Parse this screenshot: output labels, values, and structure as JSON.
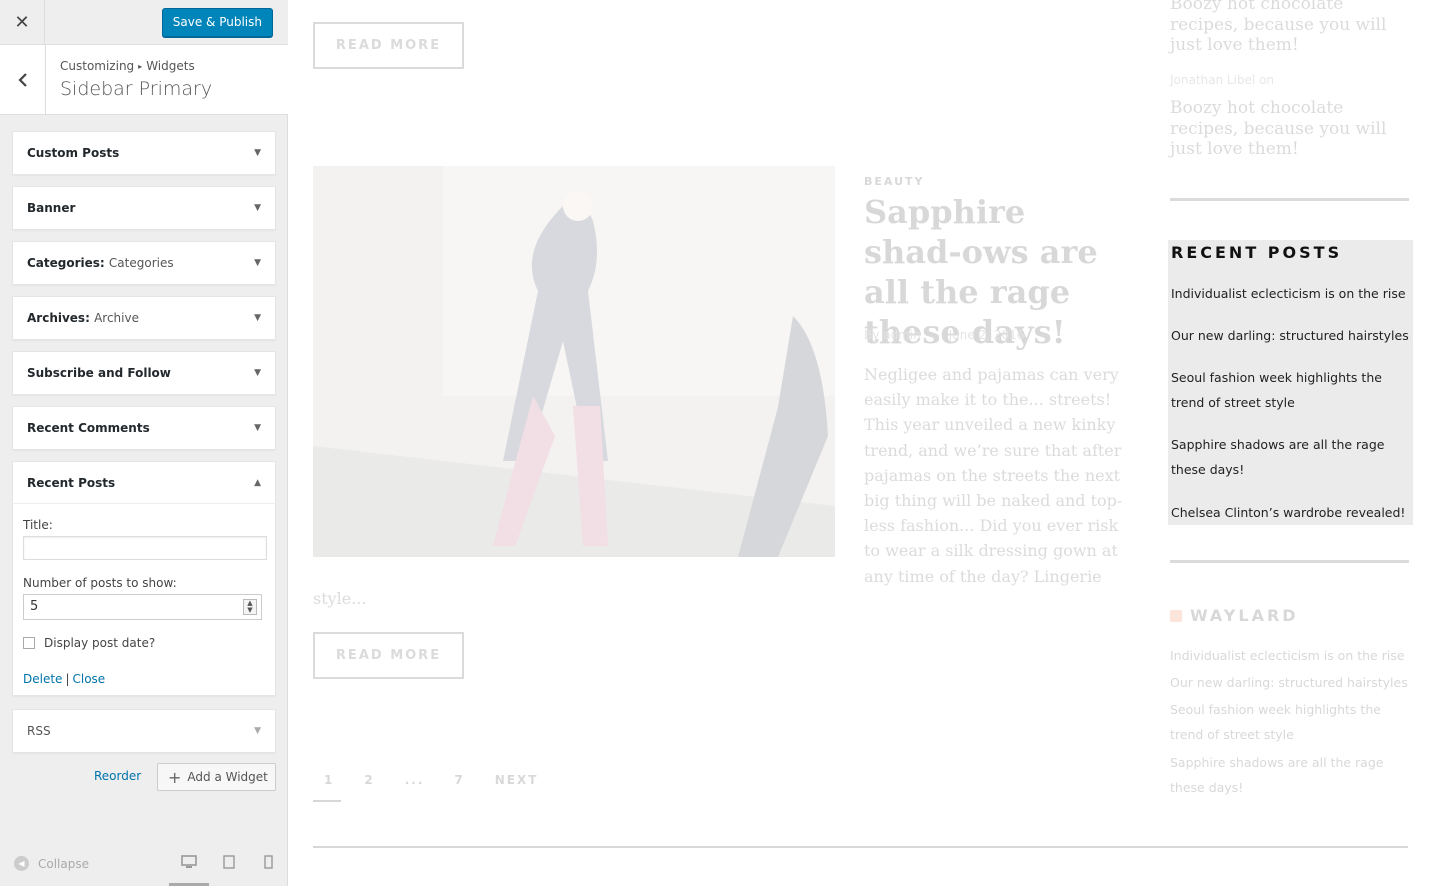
{
  "customizer": {
    "close_label": "✕",
    "save_label": "Save & Publish",
    "breadcrumb": {
      "root": "Customizing",
      "sep": "▸",
      "current": "Widgets"
    },
    "section_title": "Sidebar Primary",
    "widgets": [
      {
        "name": "Custom Posts",
        "sub": ""
      },
      {
        "name": "Banner",
        "sub": ""
      },
      {
        "name": "Categories:",
        "sub": "Categories"
      },
      {
        "name": "Archives:",
        "sub": "Archive"
      },
      {
        "name": "Subscribe and Follow",
        "sub": ""
      },
      {
        "name": "Recent Comments",
        "sub": ""
      }
    ],
    "open_widget": {
      "name": "Recent Posts",
      "title_label": "Title:",
      "title_value": "",
      "count_label": "Number of posts to show:",
      "count_value": "5",
      "show_date_label": "Display post date?",
      "delete_label": "Delete",
      "pipe": "|",
      "close_label": "Close"
    },
    "rss_widget": {
      "name": "RSS"
    },
    "reorder_label": "Reorder",
    "add_widget_label": "Add a Widget",
    "collapse_label": "Collapse"
  },
  "preview": {
    "read_more": "READ MORE",
    "post": {
      "category": "BEAUTY",
      "title": "Sapphire shad-ows are all the rage these days!",
      "author": "By admin",
      "date": "June 2, 2016",
      "excerpt": "Negligee and pajamas can very easily make it to the... streets! This year unveiled a new kinky trend, and we’re sure that after pajamas on the streets the next big thing will be naked and top-less fashion... Did you ever risk to wear a silk dressing gown at any time of the day? Lingerie",
      "excerpt_tail": "style..."
    },
    "pagination": [
      "1",
      "2",
      "...",
      "7",
      "NEXT"
    ],
    "sidebar": {
      "quote_top": "Boozy hot chocolate recipes, because you will just love them!",
      "quote_author": "Jonathan Libel on",
      "quote_second": "Boozy hot chocolate recipes, because you will just love them!",
      "recent_title": "RECENT POSTS",
      "recent_items": [
        "Individualist eclecticism is on the rise",
        "Our new darling: structured hairstyles",
        "Seoul fashion week highlights the trend of street style",
        "Sapphire shadows are all the rage these days!",
        "Chelsea Clinton’s wardrobe revealed!"
      ],
      "rss_title": "WAYLARD",
      "rss_items": [
        "Individualist eclecticism is on the rise",
        "Our new darling: structured hairstyles",
        "Seoul fashion week highlights the trend of street style",
        "Sapphire shadows are all the rage these days!"
      ]
    }
  },
  "colors": {
    "primary_button": "#0085ba",
    "link": "#0073aa",
    "panel_bg": "#eeeeee"
  }
}
